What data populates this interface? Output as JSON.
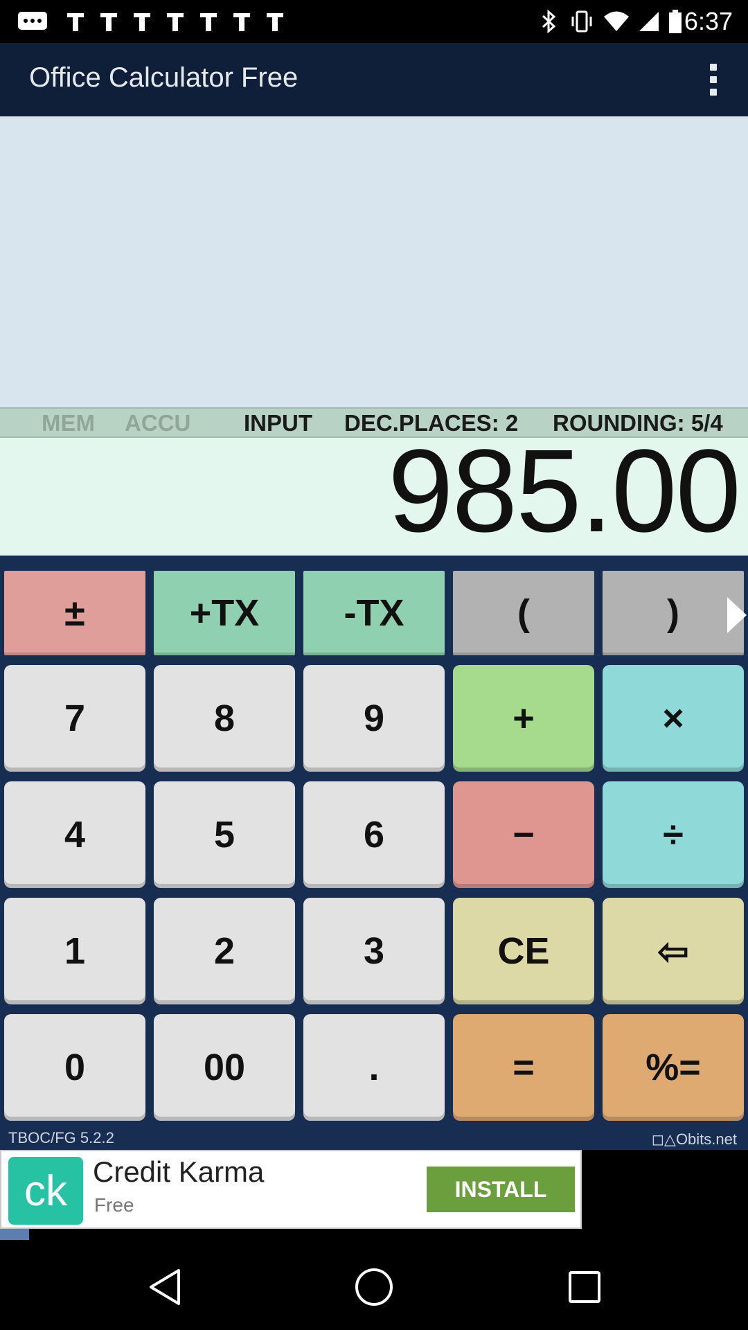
{
  "status_bar": {
    "time": "6:37",
    "icons": [
      "messages-icon",
      "image-icon",
      "image-icon",
      "image-icon",
      "image-icon",
      "image-icon",
      "image-icon",
      "image-icon",
      "bluetooth-icon",
      "vibrate-icon",
      "wifi-icon",
      "signal-icon",
      "battery-icon"
    ]
  },
  "app_bar": {
    "title": "Office Calculator Free",
    "menu_icon": "overflow-menu-icon"
  },
  "status_strip": {
    "mem": "MEM",
    "accu": "ACCU",
    "input": "INPUT",
    "dec_places": "DEC.PLACES: 2",
    "rounding": "ROUNDING: 5/4"
  },
  "display": {
    "value": "985.00"
  },
  "keys": {
    "row0": [
      "±",
      "+TX",
      "-TX",
      "(",
      ")"
    ],
    "row1": [
      "7",
      "8",
      "9",
      "+",
      "×"
    ],
    "row2": [
      "4",
      "5",
      "6",
      "−",
      "÷"
    ],
    "row3": [
      "1",
      "2",
      "3",
      "CE",
      "⇦"
    ],
    "row4": [
      "0",
      "00",
      ".",
      "=",
      "%="
    ]
  },
  "footer": {
    "version": "TBOC/FG 5.2.2",
    "brand": "◻△Obits.net"
  },
  "ad": {
    "logo": "ck",
    "title": "Credit Karma",
    "subtitle": "Free",
    "button": "INSTALL"
  },
  "colors": {
    "app_bar": "#0f1f3a",
    "keypad_bg": "#172d52",
    "display_bg": "#e4f7ef",
    "tape_bg": "#d8e5ef"
  }
}
